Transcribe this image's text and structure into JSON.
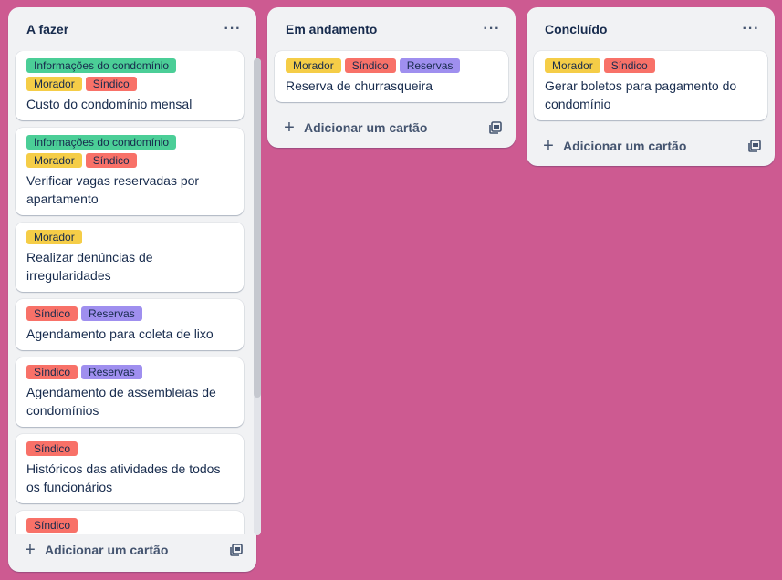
{
  "colors": {
    "board_bg": "#cd5a91",
    "label_green": "#4bce97",
    "label_yellow": "#f5cd47",
    "label_red": "#f87168",
    "label_purple": "#9f8fef"
  },
  "lists": [
    {
      "title": "A fazer",
      "menu_icon": "ellipsis-icon",
      "add_label": "Adicionar um cartão",
      "cards": [
        {
          "labels": [
            {
              "text": "Informações do condomínio",
              "color": "#4bce97"
            },
            {
              "text": "Morador",
              "color": "#f5cd47"
            },
            {
              "text": "Síndico",
              "color": "#f87168"
            }
          ],
          "title": "Custo do condomínio mensal"
        },
        {
          "labels": [
            {
              "text": "Informações do condomínio",
              "color": "#4bce97"
            },
            {
              "text": "Morador",
              "color": "#f5cd47"
            },
            {
              "text": "Síndico",
              "color": "#f87168"
            }
          ],
          "title": "Verificar vagas reservadas por apartamento"
        },
        {
          "labels": [
            {
              "text": "Morador",
              "color": "#f5cd47"
            }
          ],
          "title": "Realizar denúncias de irregularidades"
        },
        {
          "labels": [
            {
              "text": "Síndico",
              "color": "#f87168"
            },
            {
              "text": "Reservas",
              "color": "#9f8fef"
            }
          ],
          "title": "Agendamento para coleta de lixo"
        },
        {
          "labels": [
            {
              "text": "Síndico",
              "color": "#f87168"
            },
            {
              "text": "Reservas",
              "color": "#9f8fef"
            }
          ],
          "title": "Agendamento de assembleias de condomínios"
        },
        {
          "labels": [
            {
              "text": "Síndico",
              "color": "#f87168"
            }
          ],
          "title": "Históricos das atividades de todos os funcionários"
        },
        {
          "labels": [
            {
              "text": "Síndico",
              "color": "#f87168"
            }
          ],
          "title": ""
        }
      ]
    },
    {
      "title": "Em andamento",
      "menu_icon": "ellipsis-icon",
      "add_label": "Adicionar um cartão",
      "cards": [
        {
          "labels": [
            {
              "text": "Morador",
              "color": "#f5cd47"
            },
            {
              "text": "Síndico",
              "color": "#f87168"
            },
            {
              "text": "Reservas",
              "color": "#9f8fef"
            }
          ],
          "title": "Reserva de churrasqueira"
        }
      ]
    },
    {
      "title": "Concluído",
      "menu_icon": "ellipsis-icon",
      "add_label": "Adicionar um cartão",
      "cards": [
        {
          "labels": [
            {
              "text": "Morador",
              "color": "#f5cd47"
            },
            {
              "text": "Síndico",
              "color": "#f87168"
            }
          ],
          "title": "Gerar boletos para pagamento do condomínio"
        }
      ]
    }
  ]
}
